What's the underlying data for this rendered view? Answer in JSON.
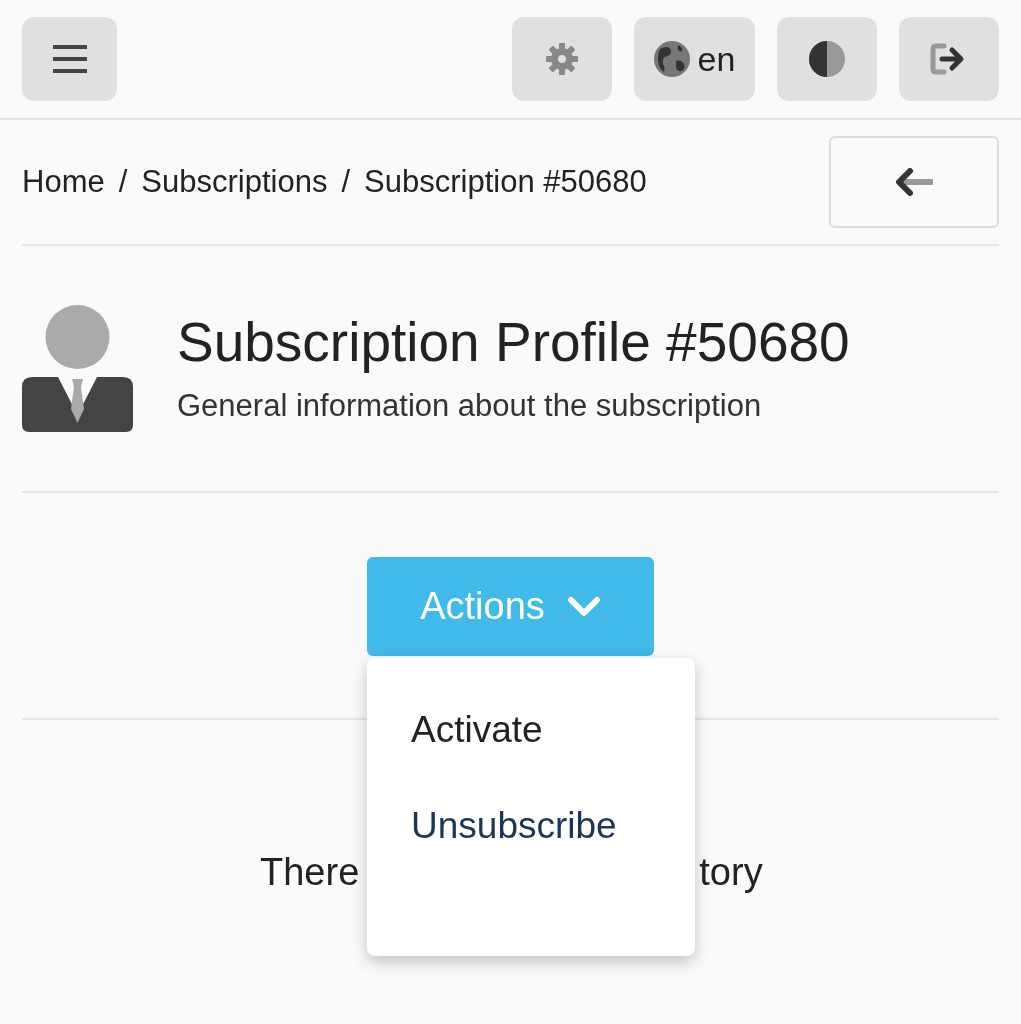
{
  "top_bar": {
    "language": "en"
  },
  "breadcrumb": [
    "Home",
    "Subscriptions",
    "Subscription #50680"
  ],
  "breadcrumb_separator": "/",
  "header": {
    "title": "Subscription Profile #50680",
    "subtitle": "General information about the subscription"
  },
  "actions_button": {
    "label": "Actions",
    "expanded": true
  },
  "actions_menu": [
    {
      "label": "Activate",
      "selected": false
    },
    {
      "label": "Unsubscribe",
      "selected": true
    }
  ],
  "history_message_parts": [
    "There",
    "tory"
  ]
}
